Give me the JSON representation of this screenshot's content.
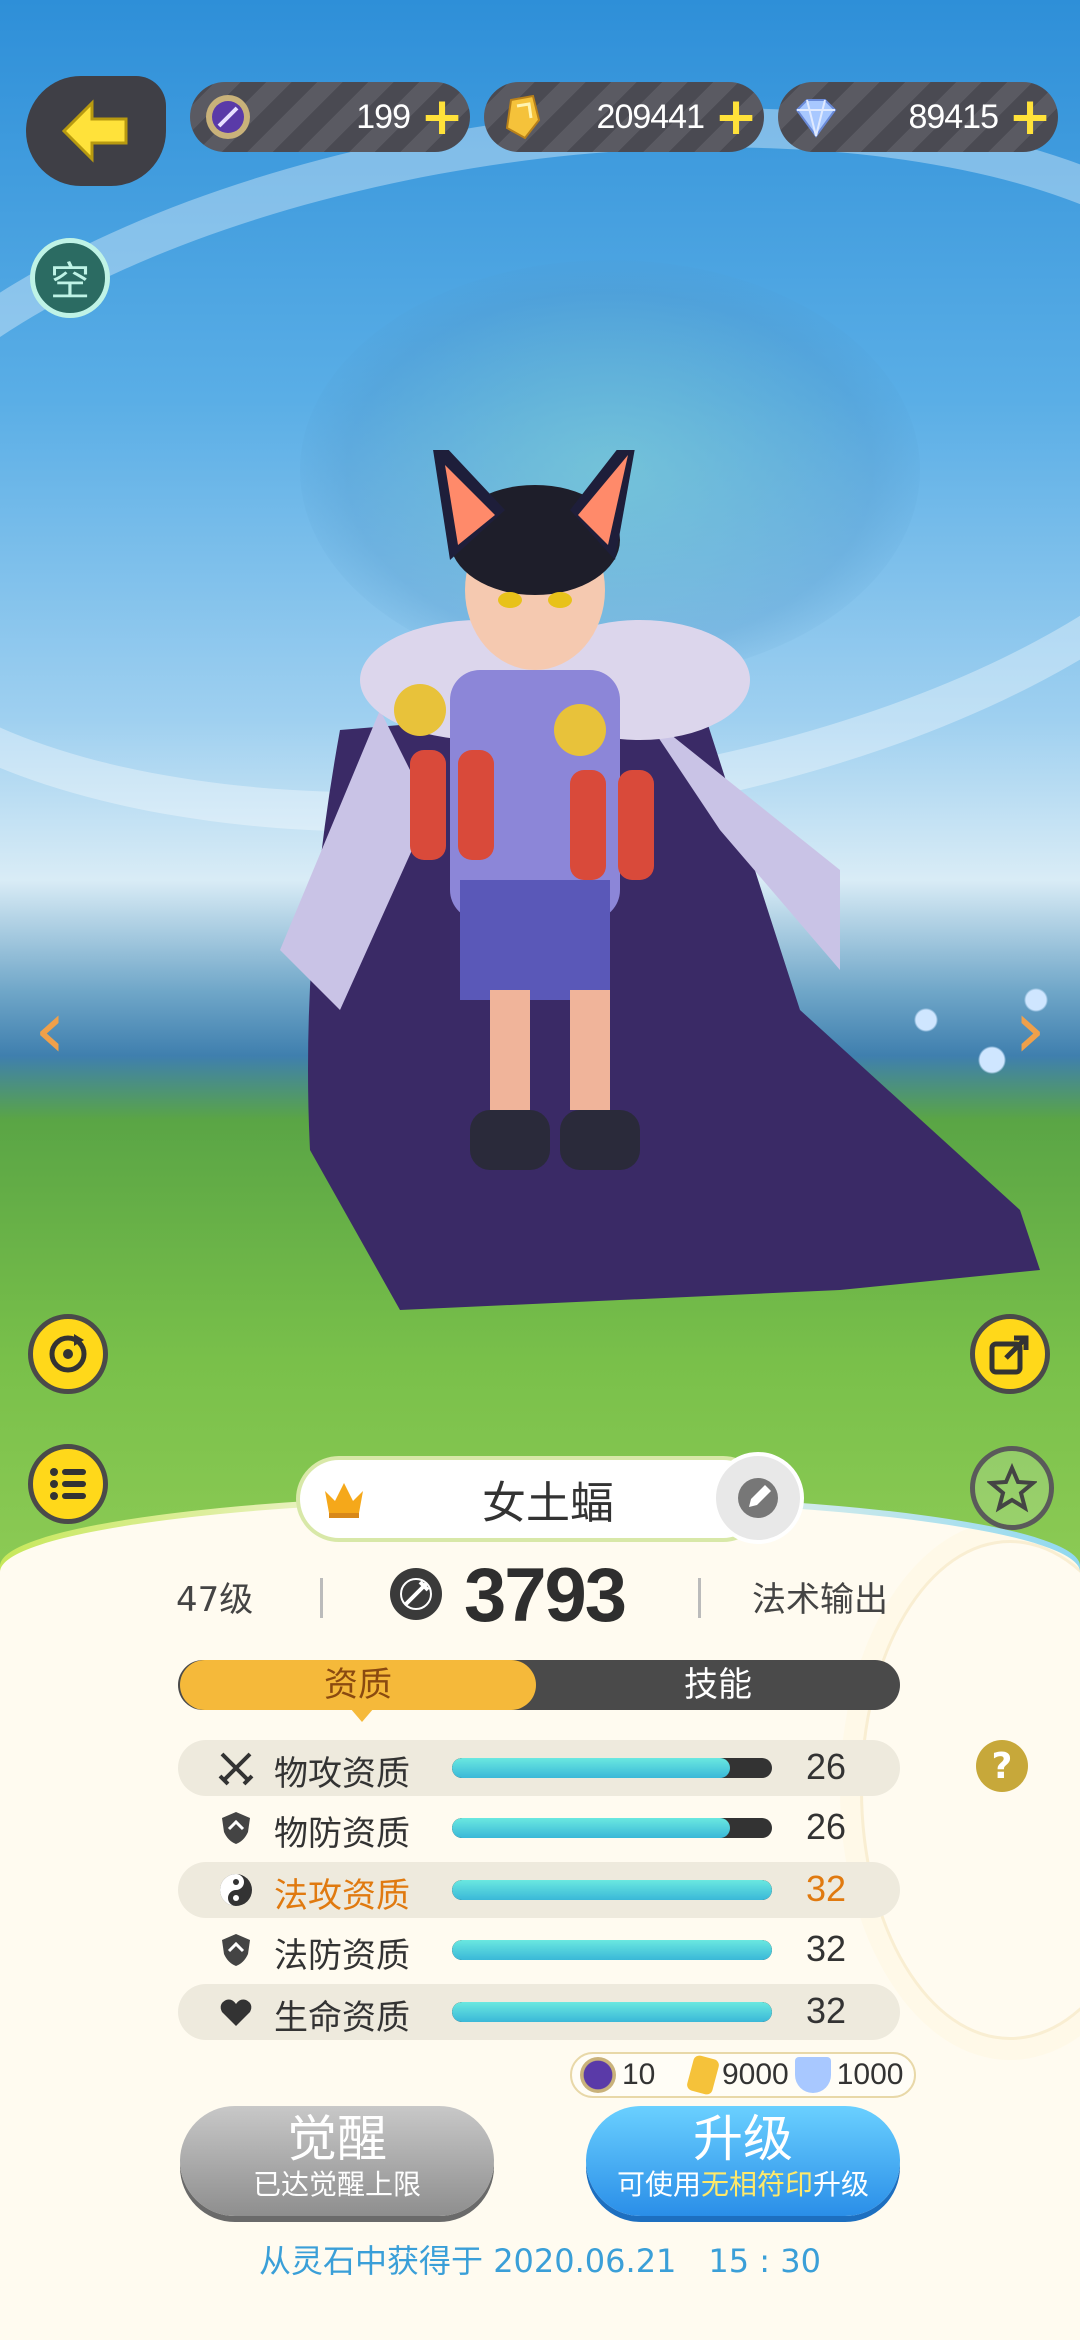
{
  "currencies": [
    {
      "icon": "spirit-orb-icon",
      "value": "199"
    },
    {
      "icon": "gold-crystal-icon",
      "value": "209441"
    },
    {
      "icon": "diamond-icon",
      "value": "89415"
    }
  ],
  "plus_glyph": "+",
  "kong_label": "空",
  "arrows": {
    "left": "‹",
    "right": "›"
  },
  "pet": {
    "name": "女土蝠",
    "level": "47级",
    "power": "3793",
    "role": "法术输出"
  },
  "tabs": [
    {
      "label": "资质",
      "active": true
    },
    {
      "label": "技能",
      "active": false
    }
  ],
  "attributes": [
    {
      "icon": "crossed-swords-icon",
      "label": "物攻资质",
      "value": "26",
      "fill": 0.87,
      "highlight": false,
      "shaded": true
    },
    {
      "icon": "shield-icon",
      "label": "物防资质",
      "value": "26",
      "fill": 0.87,
      "highlight": false,
      "shaded": false
    },
    {
      "icon": "yin-yang-icon",
      "label": "法攻资质",
      "value": "32",
      "fill": 1.0,
      "highlight": true,
      "shaded": true
    },
    {
      "icon": "shield-icon",
      "label": "法防资质",
      "value": "32",
      "fill": 1.0,
      "highlight": false,
      "shaded": false
    },
    {
      "icon": "heart-icon",
      "label": "生命资质",
      "value": "32",
      "fill": 1.0,
      "highlight": false,
      "shaded": true
    }
  ],
  "help_glyph": "?",
  "cost": {
    "orb": "10",
    "gold": "9000",
    "diamond": "1000"
  },
  "buttons": {
    "awaken": {
      "title": "觉醒",
      "sub": "已达觉醒上限"
    },
    "upgrade": {
      "title": "升级",
      "sub_prefix": "可使用",
      "sub_highlight": "无相符印",
      "sub_suffix": "升级"
    }
  },
  "obtained": "从灵石中获得于 2020.06.21　15 : 30",
  "colors": {
    "accent_yellow": "#ffd81a",
    "tab_active": "#f5b93a",
    "upgrade_blue": "#2a8ee8",
    "highlight_orange": "#e07a10"
  }
}
